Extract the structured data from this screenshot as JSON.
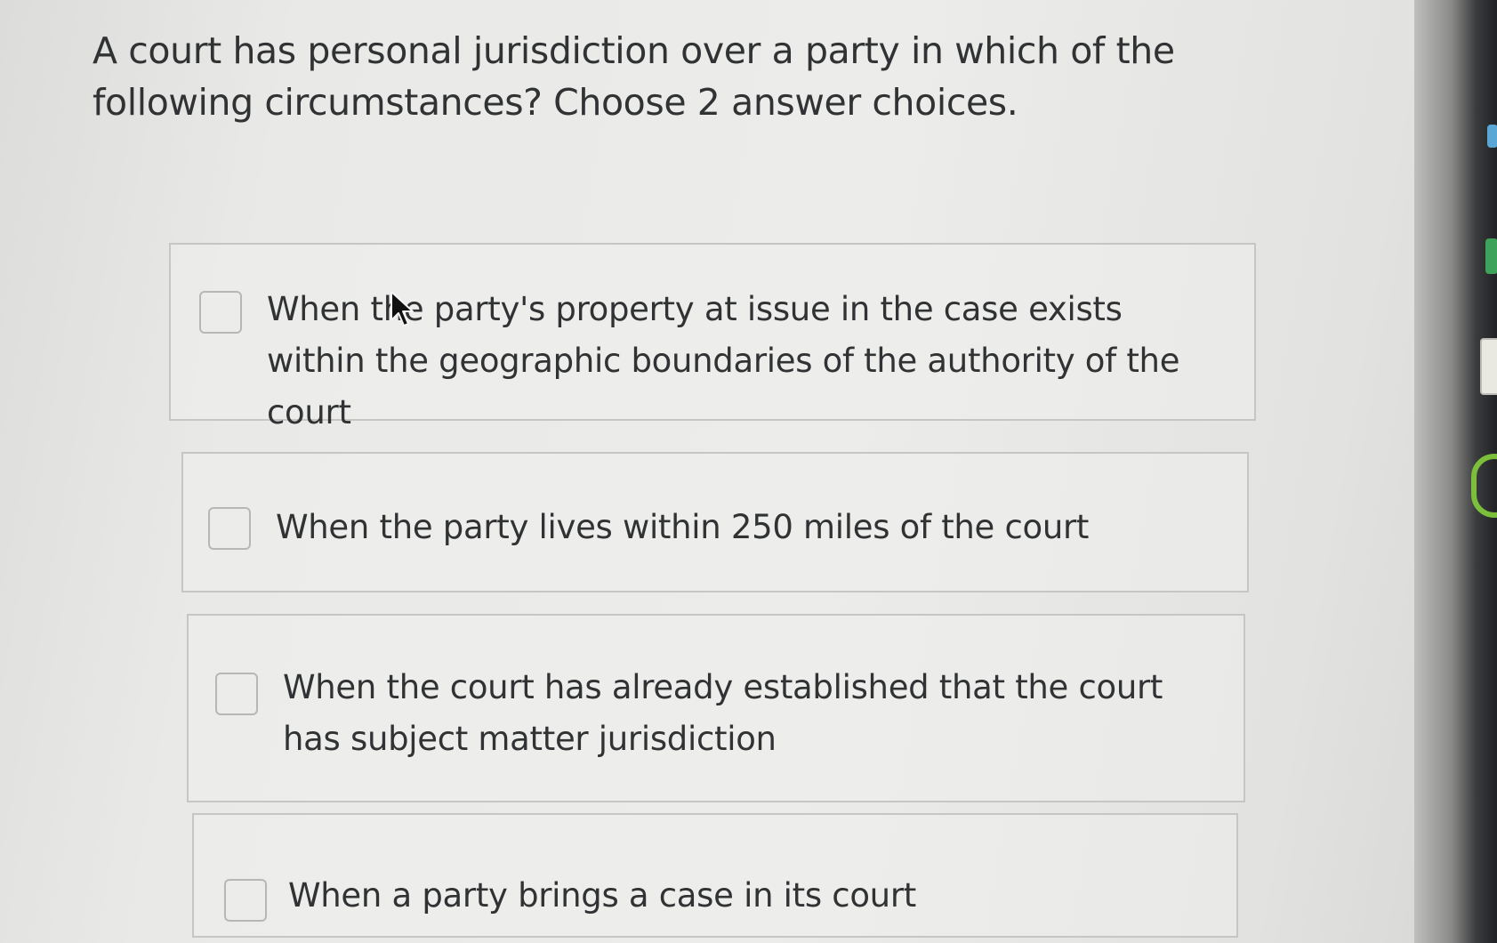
{
  "question": {
    "text": "A court has personal jurisdiction over a party in which of the following circumstances? Choose 2 answer choices."
  },
  "options": [
    {
      "label": "When the party's property at issue in the case exists within the geographic boundaries of the authority of the court",
      "checked": false
    },
    {
      "label": "When the party lives within 250 miles of the court",
      "checked": false
    },
    {
      "label": "When the court has already established that the court has subject matter jurisdiction",
      "checked": false
    },
    {
      "label": "When a party brings a case in its court",
      "checked": false
    }
  ],
  "cursor": {
    "icon": "mouse-pointer-icon"
  },
  "colors": {
    "text": "#303234",
    "card_border": "#c6c6c4",
    "checkbox_border": "#b7b7b5"
  }
}
